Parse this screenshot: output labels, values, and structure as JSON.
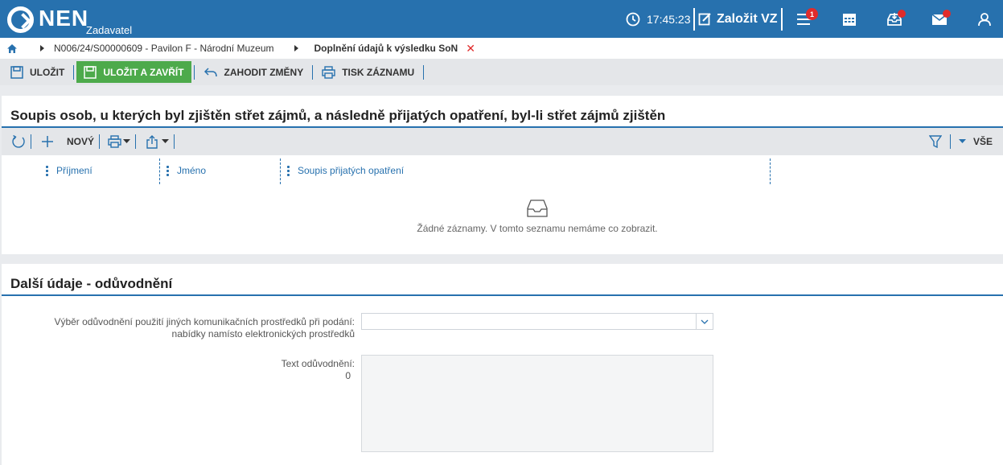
{
  "header": {
    "logo_text": "NEN",
    "logo_sub": "Zadavatel",
    "time": "17:45:23",
    "create_label": "Založit VZ",
    "menu_badge": "1",
    "icons": [
      "clock-icon",
      "edit-icon",
      "hamburger-menu-icon",
      "calendar-icon",
      "inbox-icon",
      "mail-icon",
      "user-icon"
    ],
    "brand_color": "#2771ae"
  },
  "breadcrumb": {
    "items": [
      "N006/24/S00000609 - Pavilon F - Národní Muzeum",
      "Doplnění údajů k výsledku SoN"
    ],
    "close_symbol": "✕"
  },
  "toolbar": {
    "save_label": "ULOŽIT",
    "save_close_label": "ULOŽIT A ZAVŘÍT",
    "discard_label": "ZAHODIT ZMĚNY",
    "print_label": "TISK ZÁZNAMU",
    "accent_green": "#4daa4b"
  },
  "section1": {
    "title": "Soupis osob, u kterých byl zjištěn střet zájmů, a následně přijatých opatření, byl-li střet zájmů zjištěn",
    "new_label": "NOVÝ",
    "filter_all_label": "VŠE",
    "columns": [
      "Příjmení",
      "Jméno",
      "Soupis přijatých opatření"
    ],
    "empty_text": "Žádné záznamy. V tomto seznamu nemáme co zobrazit."
  },
  "section2": {
    "title": "Další údaje - odůvodnění",
    "select_label_line1": "Výběr odůvodnění použití jiných komunikačních prostředků při podání:",
    "select_label_line2": "nabídky namísto elektronických prostředků",
    "select_value": "",
    "text_label": "Text odůvodnění:",
    "text_count": "0",
    "text_value": ""
  }
}
